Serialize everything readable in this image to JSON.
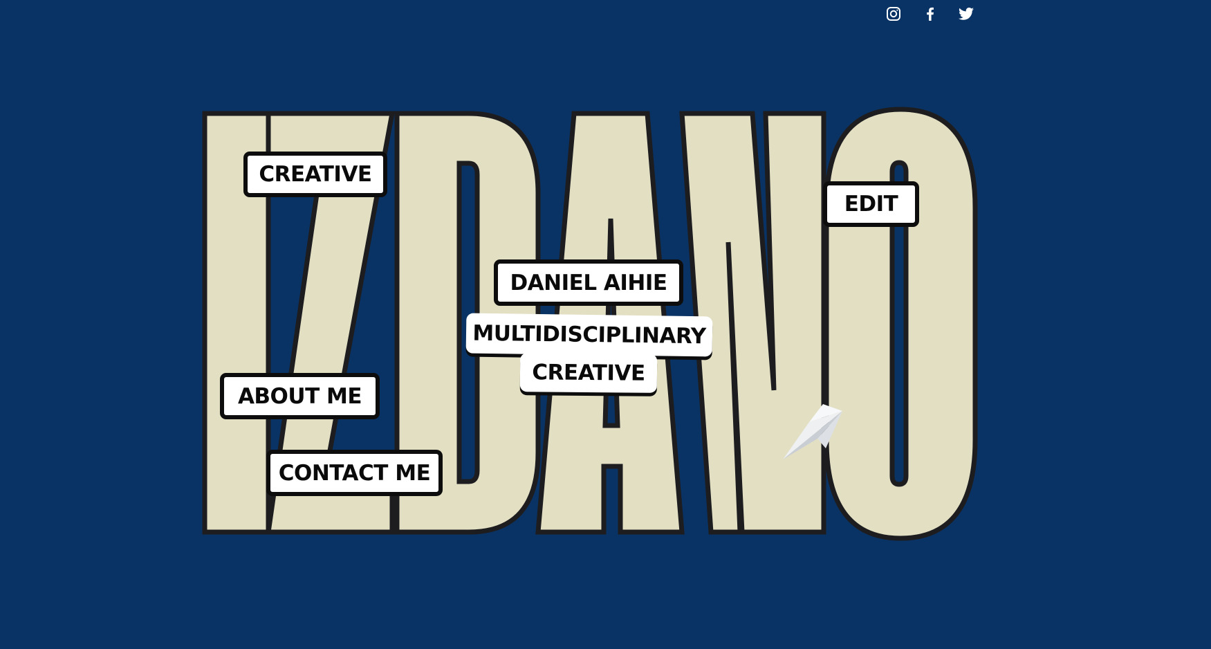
{
  "social": {
    "items": [
      {
        "icon": "instagram-icon"
      },
      {
        "icon": "facebook-icon"
      },
      {
        "icon": "twitter-icon"
      }
    ]
  },
  "logo": {
    "text": "IZDANO",
    "fill_color": "#e2dfc3",
    "outline_color": "#1d1d1f"
  },
  "nav": {
    "creative_label": "CREATIVE",
    "edit_label": "EDIT",
    "name_label": "DANIEL AIHIE",
    "about_label": "ABOUT ME",
    "contact_label": "CONTACT ME"
  },
  "tagline": {
    "line1": "MULTIDISCIPLINARY",
    "line2": "CREATIVE"
  },
  "colors": {
    "background": "#0a3365",
    "tag_background": "#ffffff",
    "tag_border": "#0d0d0d"
  },
  "decoration": {
    "icon": "paper-plane-icon"
  }
}
